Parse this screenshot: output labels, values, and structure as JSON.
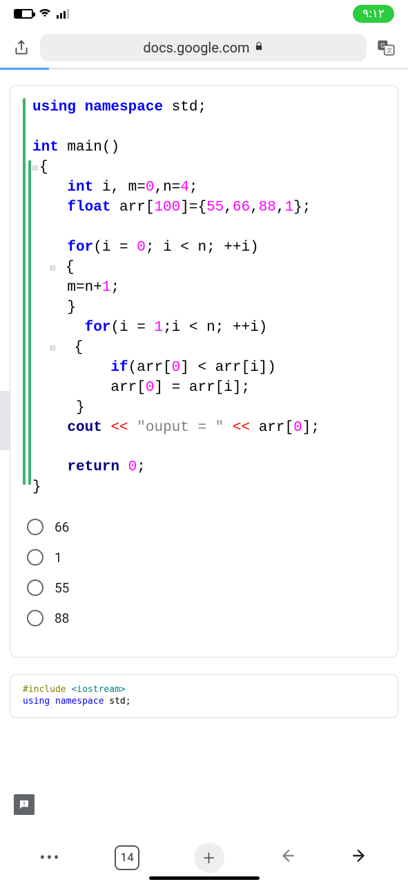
{
  "status_bar": {
    "time": "۹:۱۲"
  },
  "url_bar": {
    "domain": "docs.google.com"
  },
  "code": {
    "line1_using": "using",
    "line1_namespace": "namespace",
    "line1_std": "std",
    "line2_int": "int",
    "line2_main": "main",
    "line3_brace": "{",
    "line4_int": "int",
    "line4_rest": " i, m=",
    "line4_z": "0",
    "line4_c": ",n=",
    "line4_four": "4",
    "line5_float": "float",
    "line5_arr": " arr[",
    "line5_100": "100",
    "line5_eq": "]={",
    "line5_v1": "55",
    "line5_v2": "66",
    "line5_v3": "88",
    "line5_v4": "1",
    "line6_for": "for",
    "line6_body": "(i = ",
    "line6_z": "0",
    "line6_rest": "; i < n; ++i)",
    "line7_brace": "{",
    "line8": "m=n+",
    "line8_one": "1",
    "line9_brace": "}",
    "line10_for": "for",
    "line10_body": "(i = ",
    "line10_one": "1",
    "line10_rest": ";i < n; ++i)",
    "line11_brace": "{",
    "line12_if": "if",
    "line12_body": "(arr[",
    "line12_z": "0",
    "line12_mid": "] < arr[i])",
    "line13_body": "arr[",
    "line13_z": "0",
    "line13_rest": "] = arr[i];",
    "line14_brace": "}",
    "line15_cout": "cout ",
    "line15_op": "<<",
    "line15_str": " \"ouput = \" ",
    "line15_op2": "<<",
    "line15_arr": " arr[",
    "line15_z": "0",
    "line15_end": "];",
    "line16_return": "return",
    "line16_z": " 0",
    "line17_brace": "}"
  },
  "options": {
    "o1": "66",
    "o2": "1",
    "o3": "55",
    "o4": "88"
  },
  "peek": {
    "l1a": "#include",
    "l1b": " <iostream>",
    "l2a": "using",
    "l2b": " namespace",
    "l2c": " std",
    "l2d": ";"
  },
  "bottom_nav": {
    "tab_count": "14"
  }
}
